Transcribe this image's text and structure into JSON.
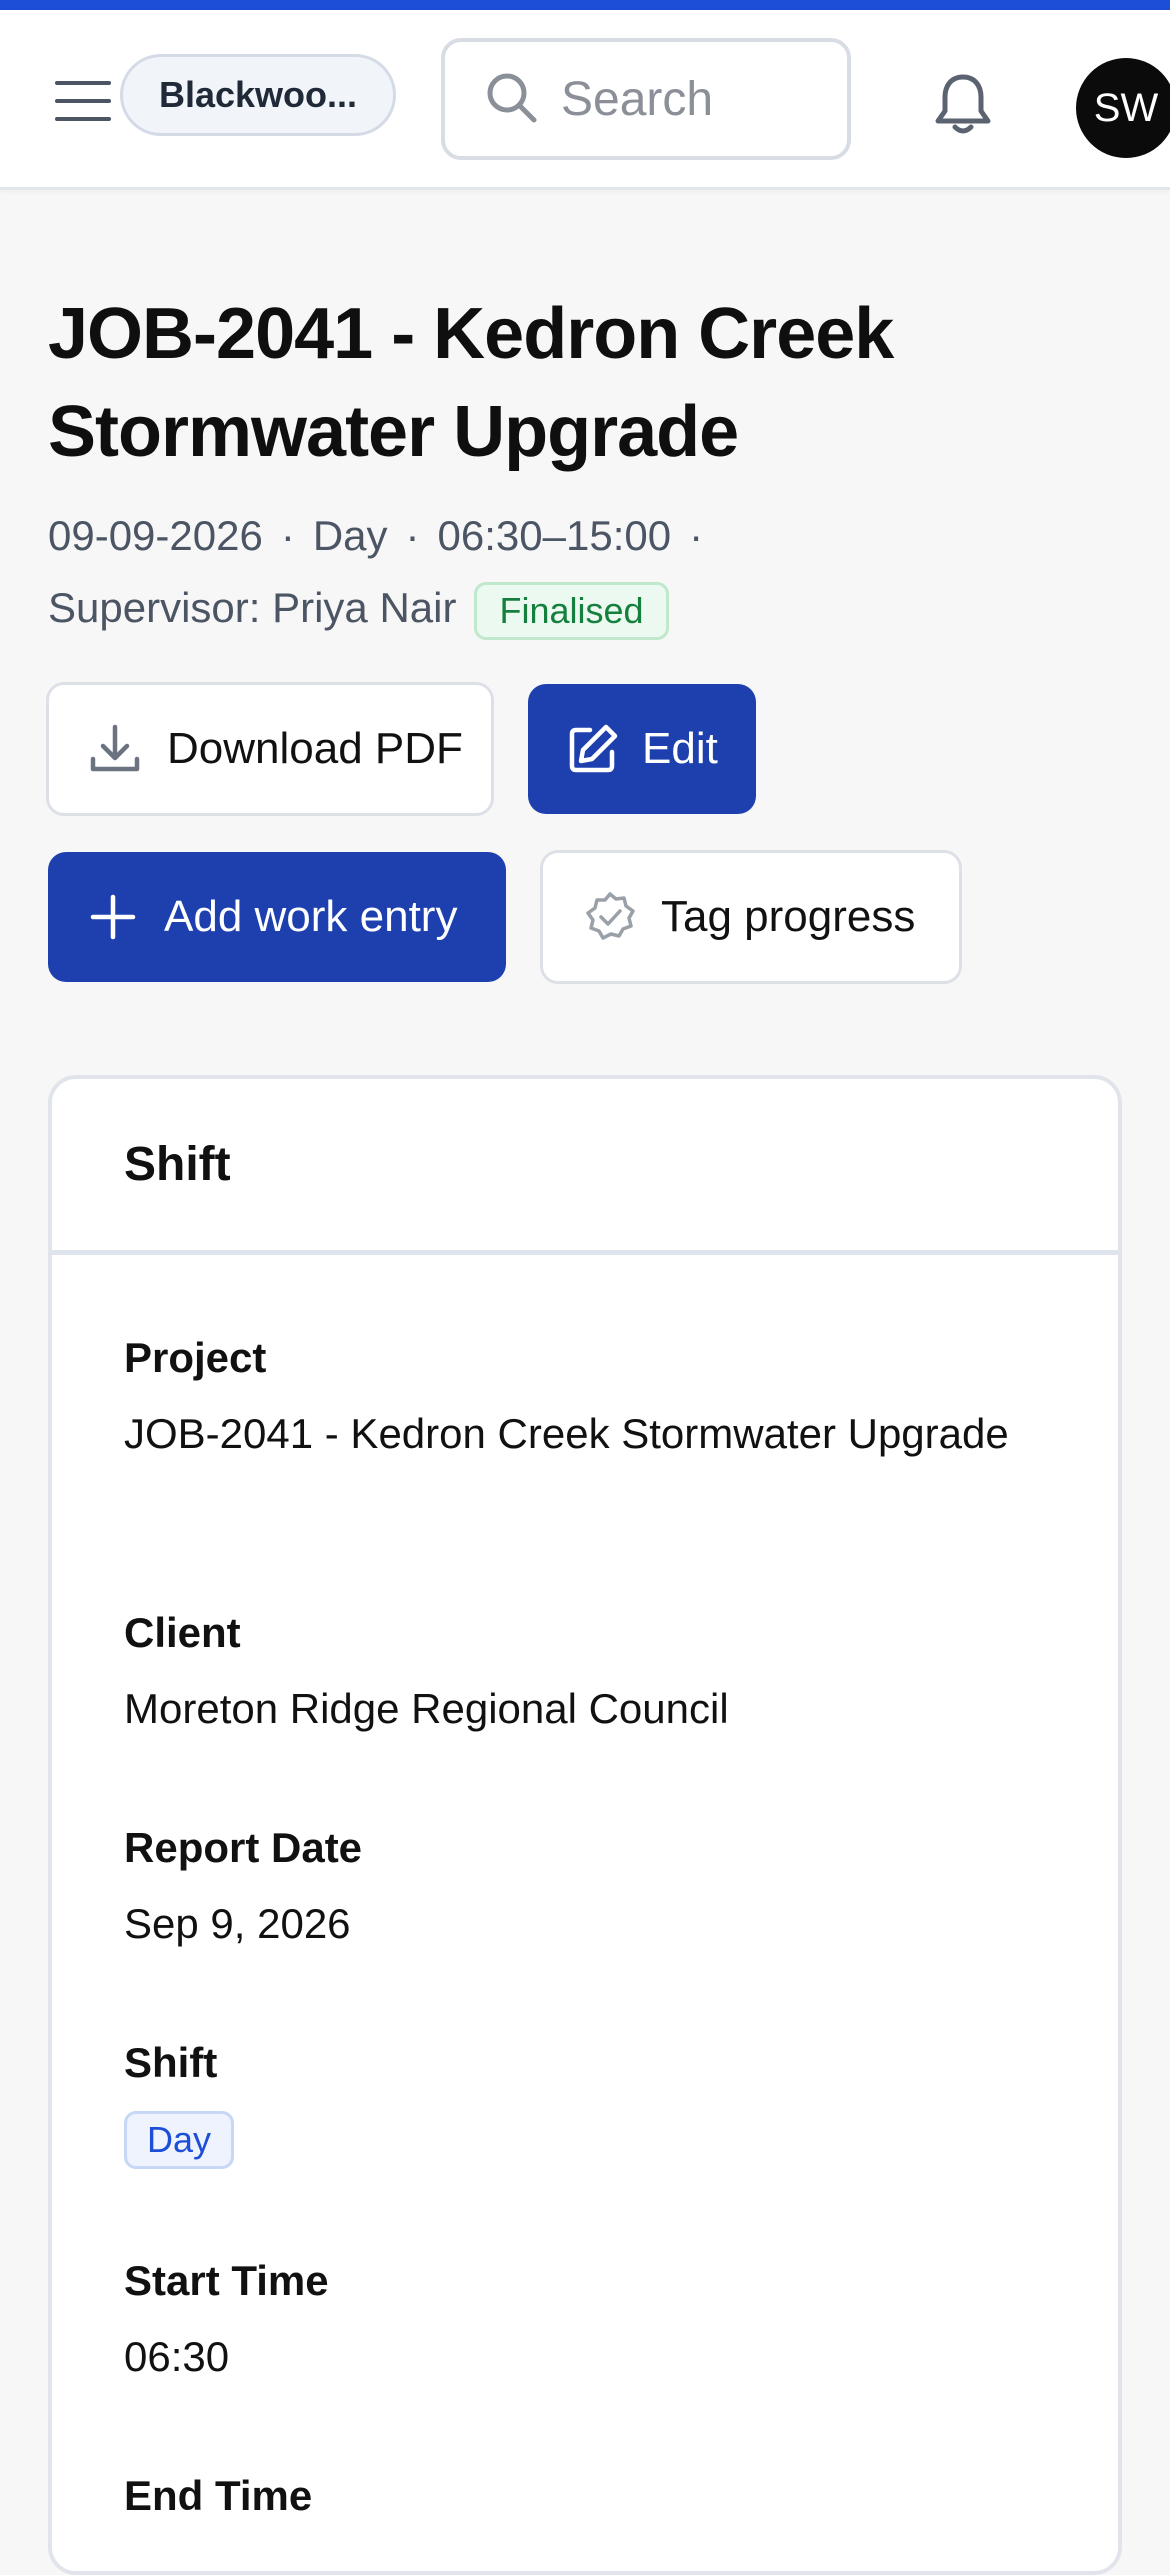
{
  "header": {
    "org_name": "Blackwoo...",
    "search_placeholder": "Search",
    "avatar_initials": "SW"
  },
  "page": {
    "title": "JOB-2041 - Kedron Creek Stormwater Upgrade",
    "date": "09-09-2026",
    "shift": "Day",
    "time_range": "06:30–15:00",
    "supervisor": "Supervisor: Priya Nair",
    "status": "Finalised",
    "separator": "·"
  },
  "actions": {
    "download_pdf": "Download PDF",
    "edit": "Edit",
    "add_work_entry": "Add work entry",
    "tag_progress": "Tag progress"
  },
  "card": {
    "title": "Shift",
    "fields": [
      {
        "label": "Project",
        "value": "JOB-2041 - Kedron Creek Stormwater Upgrade"
      },
      {
        "label": "Client",
        "value": "Moreton Ridge Regional Council"
      },
      {
        "label": "Report Date",
        "value": "Sep 9, 2026"
      },
      {
        "label": "Shift",
        "value": "Day"
      },
      {
        "label": "Start Time",
        "value": "06:30"
      },
      {
        "label": "End Time",
        "value": ""
      }
    ]
  },
  "colors": {
    "accent": "#1d4ed8",
    "primary_button": "#1e40af",
    "status_green": "#15803d",
    "badge_blue": "#1d4ed8"
  },
  "icons": [
    "menu-icon",
    "search-icon",
    "bell-icon",
    "download-icon",
    "edit-icon",
    "plus-icon",
    "check-circle-icon"
  ]
}
